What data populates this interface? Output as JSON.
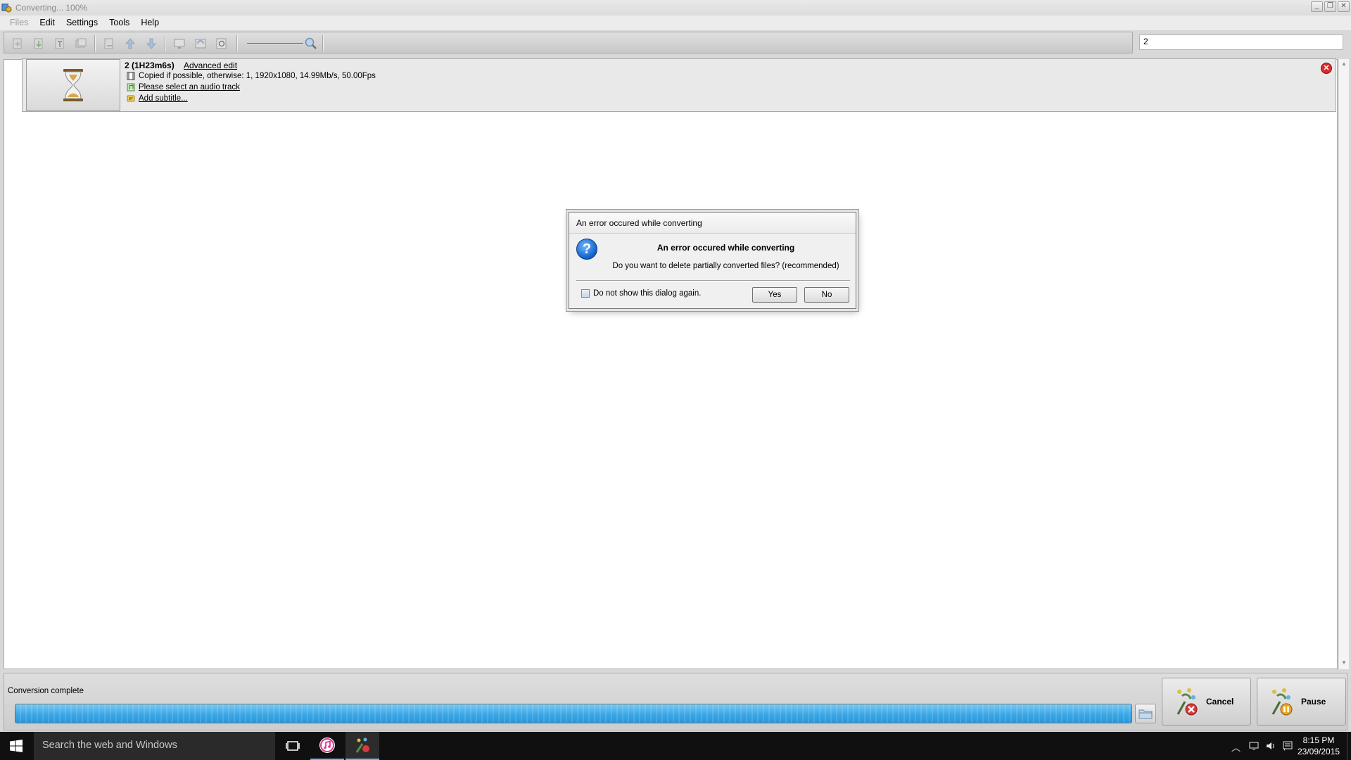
{
  "window": {
    "title": "Converting... 100%",
    "controls": [
      "minimize",
      "restore",
      "close"
    ]
  },
  "menu": {
    "items": [
      {
        "label": "Files",
        "disabled": true
      },
      {
        "label": "Edit",
        "disabled": false
      },
      {
        "label": "Settings",
        "disabled": false
      },
      {
        "label": "Tools",
        "disabled": false
      },
      {
        "label": "Help",
        "disabled": false
      }
    ]
  },
  "toolbar": {
    "icons": [
      "add-file-icon",
      "add-folder-icon",
      "text-icon",
      "batch-icon",
      "remove-icon",
      "move-up-icon",
      "move-down-icon",
      "screen-icon",
      "refresh-icon",
      "preview-icon",
      "zoom-icon"
    ],
    "search_value": "2"
  },
  "task": {
    "title": "2 (1H23m6s)",
    "advanced_edit": "Advanced edit",
    "video_line": "Copied if possible, otherwise: 1, 1920x1080, 14.99Mb/s, 50.00Fps",
    "audio_line": "Please select an audio track",
    "subtitle_line": "Add subtitle..."
  },
  "dialog": {
    "title": "An error occured while converting",
    "heading": "An error occured while converting",
    "message": "Do you want to delete partially converted files? (recommended)",
    "checkbox_label": "Do not show this dialog again.",
    "checkbox_checked": false,
    "yes_label": "Yes",
    "no_label": "No"
  },
  "status": {
    "text": "Conversion complete",
    "progress": 1.0,
    "cancel_label": "Cancel",
    "pause_label": "Pause"
  },
  "taskbar": {
    "search_placeholder": "Search the web and Windows",
    "time": "8:15 PM",
    "date": "23/09/2015",
    "accent": "#7fb0e6"
  }
}
